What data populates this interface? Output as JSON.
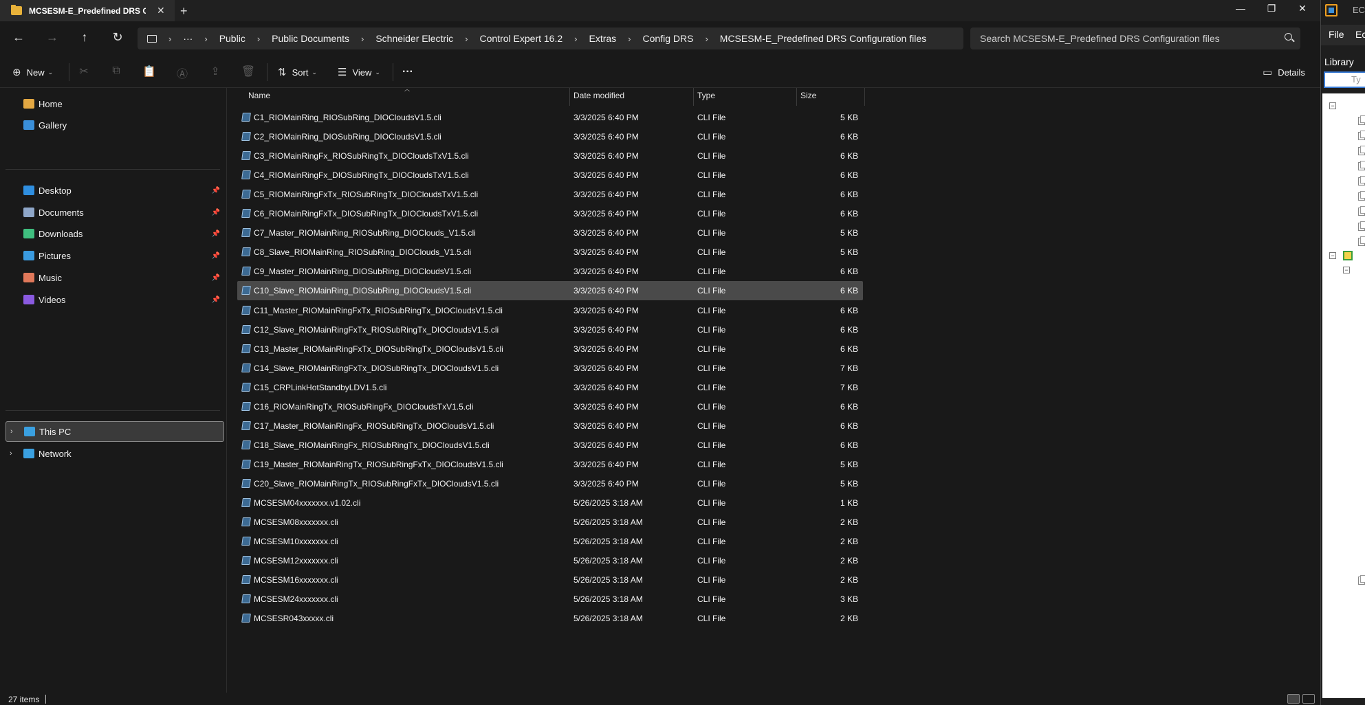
{
  "window": {
    "tab_title": "MCSESM-E_Predefined DRS Configuration files",
    "new_tab": "+",
    "tab_close": "✕",
    "minimize": "—",
    "maximize": "❐",
    "close": "✕"
  },
  "nav": {
    "back": "←",
    "forward": "→",
    "up": "↑",
    "refresh": "↻"
  },
  "breadcrumb": {
    "icon": "monitor-icon",
    "more": "···",
    "items": [
      "Public",
      "Public Documents",
      "Schneider Electric",
      "Control Expert 16.2",
      "Extras",
      "Config DRS",
      "MCSESM-E_Predefined DRS Configuration files"
    ]
  },
  "search": {
    "placeholder": "Search MCSESM-E_Predefined DRS Configuration files"
  },
  "toolbar": {
    "new_label": "New",
    "sort_label": "Sort",
    "view_label": "View",
    "more_label": "···",
    "details_label": "Details"
  },
  "sidebar": {
    "quick": [
      {
        "label": "Home",
        "icon": "home-icon",
        "color": "#e2a742"
      },
      {
        "label": "Gallery",
        "icon": "gallery-icon",
        "color": "#3a8fd9"
      }
    ],
    "pinned": [
      {
        "label": "Desktop",
        "icon": "desktop-icon",
        "color": "#2f8fe0"
      },
      {
        "label": "Documents",
        "icon": "documents-icon",
        "color": "#8fa7c9"
      },
      {
        "label": "Downloads",
        "icon": "downloads-icon",
        "color": "#3fbf7f"
      },
      {
        "label": "Pictures",
        "icon": "pictures-icon",
        "color": "#3a9be0"
      },
      {
        "label": "Music",
        "icon": "music-icon",
        "color": "#e0785a"
      },
      {
        "label": "Videos",
        "icon": "videos-icon",
        "color": "#8a5ae0"
      }
    ],
    "locations": [
      {
        "label": "This PC",
        "icon": "pc-icon",
        "color": "#3aa0e0"
      },
      {
        "label": "Network",
        "icon": "network-icon",
        "color": "#3aa0e0"
      }
    ]
  },
  "columns": {
    "name": "Name",
    "date": "Date modified",
    "type": "Type",
    "size": "Size"
  },
  "files": [
    {
      "name": "C1_RIOMainRing_RIOSubRing_DIOCloudsV1.5.cli",
      "date": "3/3/2025 6:40 PM",
      "type": "CLI File",
      "size": "5 KB"
    },
    {
      "name": "C2_RIOMainRing_DIOSubRing_DIOCloudsV1.5.cli",
      "date": "3/3/2025 6:40 PM",
      "type": "CLI File",
      "size": "6 KB"
    },
    {
      "name": "C3_RIOMainRingFx_RIOSubRingTx_DIOCloudsTxV1.5.cli",
      "date": "3/3/2025 6:40 PM",
      "type": "CLI File",
      "size": "6 KB"
    },
    {
      "name": "C4_RIOMainRingFx_DIOSubRingTx_DIOCloudsTxV1.5.cli",
      "date": "3/3/2025 6:40 PM",
      "type": "CLI File",
      "size": "6 KB"
    },
    {
      "name": "C5_RIOMainRingFxTx_RIOSubRingTx_DIOCloudsTxV1.5.cli",
      "date": "3/3/2025 6:40 PM",
      "type": "CLI File",
      "size": "6 KB"
    },
    {
      "name": "C6_RIOMainRingFxTx_DIOSubRingTx_DIOCloudsTxV1.5.cli",
      "date": "3/3/2025 6:40 PM",
      "type": "CLI File",
      "size": "6 KB"
    },
    {
      "name": "C7_Master_RIOMainRing_RIOSubRing_DIOClouds_V1.5.cli",
      "date": "3/3/2025 6:40 PM",
      "type": "CLI File",
      "size": "5 KB"
    },
    {
      "name": "C8_Slave_RIOMainRing_RIOSubRing_DIOClouds_V1.5.cli",
      "date": "3/3/2025 6:40 PM",
      "type": "CLI File",
      "size": "5 KB"
    },
    {
      "name": "C9_Master_RIOMainRing_DIOSubRing_DIOCloudsV1.5.cli",
      "date": "3/3/2025 6:40 PM",
      "type": "CLI File",
      "size": "6 KB"
    },
    {
      "name": "C10_Slave_RIOMainRing_DIOSubRing_DIOCloudsV1.5.cli",
      "date": "3/3/2025 6:40 PM",
      "type": "CLI File",
      "size": "6 KB",
      "selected": true
    },
    {
      "name": "C11_Master_RIOMainRingFxTx_RIOSubRingTx_DIOCloudsV1.5.cli",
      "date": "3/3/2025 6:40 PM",
      "type": "CLI File",
      "size": "6 KB"
    },
    {
      "name": "C12_Slave_RIOMainRingFxTx_RIOSubRingTx_DIOCloudsV1.5.cli",
      "date": "3/3/2025 6:40 PM",
      "type": "CLI File",
      "size": "6 KB"
    },
    {
      "name": "C13_Master_RIOMainRingFxTx_DIOSubRingTx_DIOCloudsV1.5.cli",
      "date": "3/3/2025 6:40 PM",
      "type": "CLI File",
      "size": "6 KB"
    },
    {
      "name": "C14_Slave_RIOMainRingFxTx_DIOSubRingTx_DIOCloudsV1.5.cli",
      "date": "3/3/2025 6:40 PM",
      "type": "CLI File",
      "size": "7 KB"
    },
    {
      "name": "C15_CRPLinkHotStandbyLDV1.5.cli",
      "date": "3/3/2025 6:40 PM",
      "type": "CLI File",
      "size": "7 KB"
    },
    {
      "name": "C16_RIOMainRingTx_RIOSubRingFx_DIOCloudsTxV1.5.cli",
      "date": "3/3/2025 6:40 PM",
      "type": "CLI File",
      "size": "6 KB"
    },
    {
      "name": "C17_Master_RIOMainRingFx_RIOSubRingTx_DIOCloudsV1.5.cli",
      "date": "3/3/2025 6:40 PM",
      "type": "CLI File",
      "size": "6 KB"
    },
    {
      "name": "C18_Slave_RIOMainRingFx_RIOSubRingTx_DIOCloudsV1.5.cli",
      "date": "3/3/2025 6:40 PM",
      "type": "CLI File",
      "size": "6 KB"
    },
    {
      "name": "C19_Master_RIOMainRingTx_RIOSubRingFxTx_DIOCloudsV1.5.cli",
      "date": "3/3/2025 6:40 PM",
      "type": "CLI File",
      "size": "5 KB"
    },
    {
      "name": "C20_Slave_RIOMainRingTx_RIOSubRingFxTx_DIOCloudsV1.5.cli",
      "date": "3/3/2025 6:40 PM",
      "type": "CLI File",
      "size": "5 KB"
    },
    {
      "name": "MCSESM04xxxxxxx.v1.02.cli",
      "date": "5/26/2025 3:18 AM",
      "type": "CLI File",
      "size": "1 KB"
    },
    {
      "name": "MCSESM08xxxxxxx.cli",
      "date": "5/26/2025 3:18 AM",
      "type": "CLI File",
      "size": "2 KB"
    },
    {
      "name": "MCSESM10xxxxxxx.cli",
      "date": "5/26/2025 3:18 AM",
      "type": "CLI File",
      "size": "2 KB"
    },
    {
      "name": "MCSESM12xxxxxxx.cli",
      "date": "5/26/2025 3:18 AM",
      "type": "CLI File",
      "size": "2 KB"
    },
    {
      "name": "MCSESM16xxxxxxx.cli",
      "date": "5/26/2025 3:18 AM",
      "type": "CLI File",
      "size": "2 KB"
    },
    {
      "name": "MCSESM24xxxxxxx.cli",
      "date": "5/26/2025 3:18 AM",
      "type": "CLI File",
      "size": "3 KB"
    },
    {
      "name": "MCSESR043xxxxx.cli",
      "date": "5/26/2025 3:18 AM",
      "type": "CLI File",
      "size": "2 KB"
    }
  ],
  "status": {
    "item_count": "27 items"
  },
  "right_app": {
    "title": "EC",
    "menu_file": "File",
    "menu_edit": "Ec",
    "library_label": "Library",
    "filter_placeholder": "Ty"
  }
}
